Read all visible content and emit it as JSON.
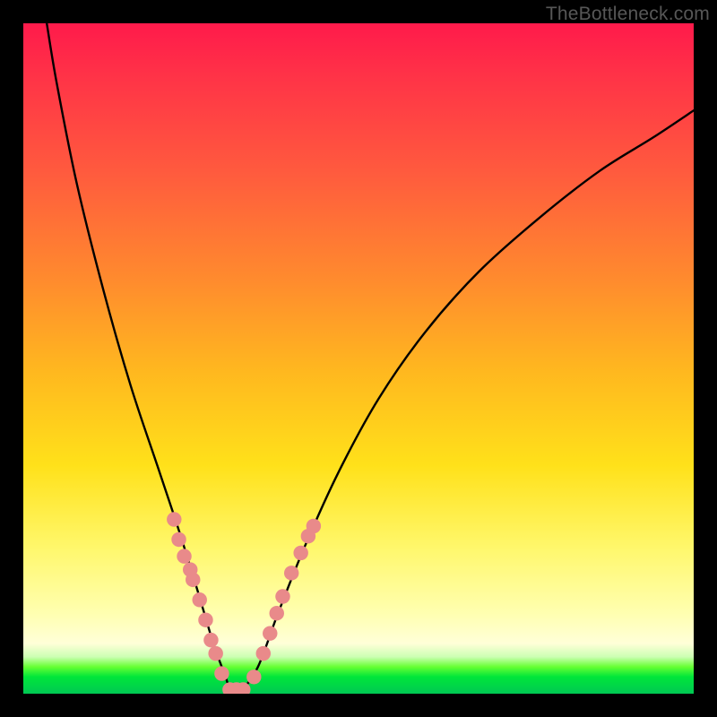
{
  "watermark": "TheBottleneck.com",
  "chart_data": {
    "type": "line",
    "title": "",
    "xlabel": "",
    "ylabel": "",
    "xlim": [
      0,
      100
    ],
    "ylim": [
      0,
      100
    ],
    "grid": false,
    "legend": false,
    "series": [
      {
        "name": "curve",
        "x": [
          3.5,
          5,
          8,
          12,
          16,
          20,
          23,
          25.5,
          27,
          28.5,
          30,
          31,
          32.5,
          35,
          38,
          42,
          47,
          53,
          60,
          68,
          77,
          86,
          94,
          100
        ],
        "values": [
          100,
          91,
          76,
          60,
          46,
          34,
          25,
          17,
          12,
          7,
          3,
          0.5,
          0.5,
          4,
          12,
          22,
          33,
          44,
          54,
          63,
          71,
          78,
          83,
          87
        ]
      }
    ],
    "markers": {
      "name": "dots",
      "color": "#e98a8a",
      "radius": 1.1,
      "points": [
        {
          "x": 22.5,
          "y": 26
        },
        {
          "x": 23.2,
          "y": 23
        },
        {
          "x": 24.0,
          "y": 20.5
        },
        {
          "x": 24.9,
          "y": 18.5
        },
        {
          "x": 25.3,
          "y": 17
        },
        {
          "x": 26.3,
          "y": 14
        },
        {
          "x": 27.2,
          "y": 11
        },
        {
          "x": 28.0,
          "y": 8
        },
        {
          "x": 28.7,
          "y": 6
        },
        {
          "x": 29.6,
          "y": 3
        },
        {
          "x": 30.8,
          "y": 0.6
        },
        {
          "x": 31.8,
          "y": 0.6
        },
        {
          "x": 32.8,
          "y": 0.6
        },
        {
          "x": 34.4,
          "y": 2.5
        },
        {
          "x": 35.8,
          "y": 6
        },
        {
          "x": 36.8,
          "y": 9
        },
        {
          "x": 37.8,
          "y": 12
        },
        {
          "x": 38.7,
          "y": 14.5
        },
        {
          "x": 40.0,
          "y": 18
        },
        {
          "x": 41.4,
          "y": 21
        },
        {
          "x": 42.5,
          "y": 23.5
        },
        {
          "x": 43.3,
          "y": 25
        }
      ]
    }
  }
}
